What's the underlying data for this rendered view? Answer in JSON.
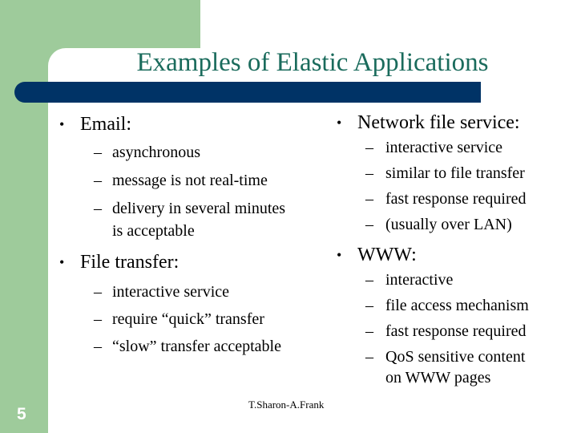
{
  "slide": {
    "title": "Examples of Elastic Applications",
    "number": "5",
    "footer": "T.Sharon-A.Frank",
    "colors": {
      "green": "#9ecb9b",
      "navy": "#003366",
      "title": "#1a6b5c"
    }
  },
  "left_column": [
    {
      "heading": "Email:",
      "items": [
        "asynchronous",
        "message is not real-time",
        "delivery in several minutes",
        "is acceptable"
      ]
    },
    {
      "heading": "File transfer:",
      "items": [
        "interactive service",
        "require “quick” transfer",
        "“slow” transfer acceptable"
      ]
    }
  ],
  "right_column": [
    {
      "heading": "Network file service:",
      "items": [
        "interactive service",
        "similar to file transfer",
        "fast response required",
        "(usually over LAN)"
      ]
    },
    {
      "heading": "WWW:",
      "items": [
        "interactive",
        "file access mechanism",
        "fast response required",
        "QoS sensitive content",
        "on WWW pages"
      ]
    }
  ],
  "glyphs": {
    "bullet": "•",
    "dash": "–"
  }
}
